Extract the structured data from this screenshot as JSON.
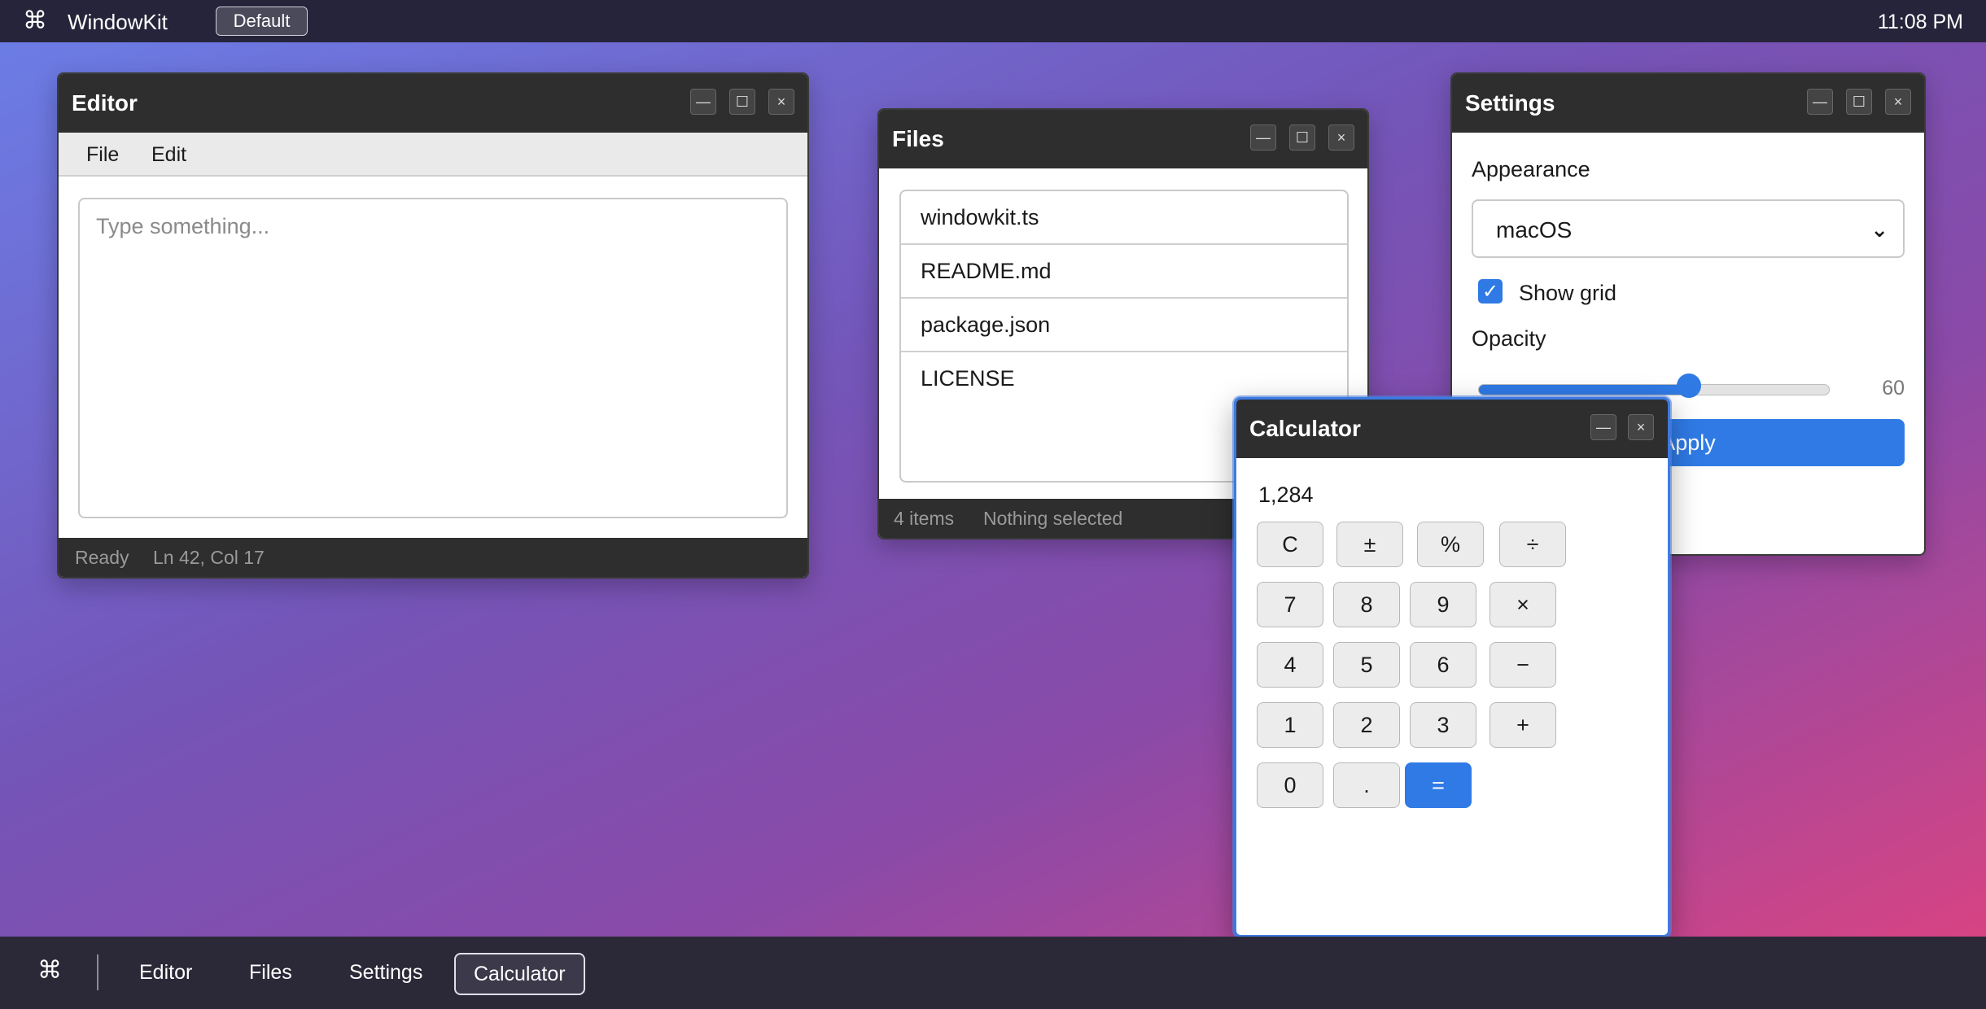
{
  "menubar": {
    "cmd_glyph": "⌘",
    "app_name": "WindowKit",
    "preset_label": "Default",
    "clock": "11:08 PM"
  },
  "editor": {
    "title": "Editor",
    "menu": [
      "File",
      "Edit"
    ],
    "placeholder": "Type something...",
    "status_left": "Ready",
    "status_right": "Ln 42, Col 17"
  },
  "files": {
    "title": "Files",
    "items": [
      "windowkit.ts",
      "README.md",
      "package.json",
      "LICENSE"
    ],
    "status_count": "4 items",
    "status_selection": "Nothing selected"
  },
  "settings": {
    "title": "Settings",
    "appearance_label": "Appearance",
    "appearance_value": "macOS",
    "show_grid_label": "Show grid",
    "show_grid_checked": true,
    "opacity_label": "Opacity",
    "opacity_value": "60",
    "opacity_fraction": 0.6,
    "apply_label": "Apply"
  },
  "calculator": {
    "title": "Calculator",
    "display": "1,284",
    "rows": [
      [
        "C",
        "±",
        "%",
        "÷"
      ],
      [
        "7",
        "8",
        "9",
        "×"
      ],
      [
        "4",
        "5",
        "6",
        "−"
      ],
      [
        "1",
        "2",
        "3",
        "+"
      ],
      [
        "0",
        ".",
        "="
      ]
    ]
  },
  "window_controls": {
    "minimize": "—",
    "maximize": "☐",
    "close": "×"
  },
  "taskbar": {
    "cmd_glyph": "⌘",
    "items": [
      "Editor",
      "Files",
      "Settings",
      "Calculator"
    ],
    "active": "Calculator"
  },
  "colors": {
    "accent": "#2f7ae5",
    "titlebar": "#2e2e2e",
    "menubar": "#26243a"
  }
}
